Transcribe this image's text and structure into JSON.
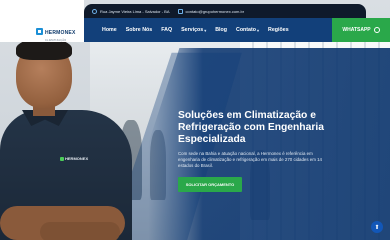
{
  "brand": {
    "name": "HERMONEX",
    "tagline": "CLIMATIZAÇÃO"
  },
  "topbar": {
    "address": "Rua Jayme Vieira Lima - Salvador - BA",
    "email": "contato@grupohermonex.com.br"
  },
  "nav": {
    "items": [
      {
        "label": "Home",
        "has_dropdown": false
      },
      {
        "label": "Sobre Nós",
        "has_dropdown": false
      },
      {
        "label": "FAQ",
        "has_dropdown": false
      },
      {
        "label": "Serviços",
        "has_dropdown": true
      },
      {
        "label": "Blog",
        "has_dropdown": false
      },
      {
        "label": "Contato",
        "has_dropdown": true
      },
      {
        "label": "Regiões",
        "has_dropdown": false
      }
    ],
    "whatsapp_label": "WHATSAPP"
  },
  "hero": {
    "title": "Soluções em Climatização e Refrigeração com Engenharia Especializada",
    "description": "Com sede na Bahia e atuação nacional, a Hermonex é referência em engenharia de climatização e refrigeração em mais de 270 cidades em 14 estados do Brasil.",
    "cta_label": "SOLICITAR ORÇAMENTO"
  },
  "shirt_logo_text": "HERMONEX",
  "colors": {
    "navy": "#12407a",
    "topbar": "#0f1a2b",
    "green": "#2aa84a",
    "logo_blue": "#1b8fd6"
  },
  "icons": {
    "address": "location-pin-icon",
    "email": "mail-icon",
    "whatsapp": "whatsapp-icon",
    "scroll_top": "arrow-up-icon"
  }
}
